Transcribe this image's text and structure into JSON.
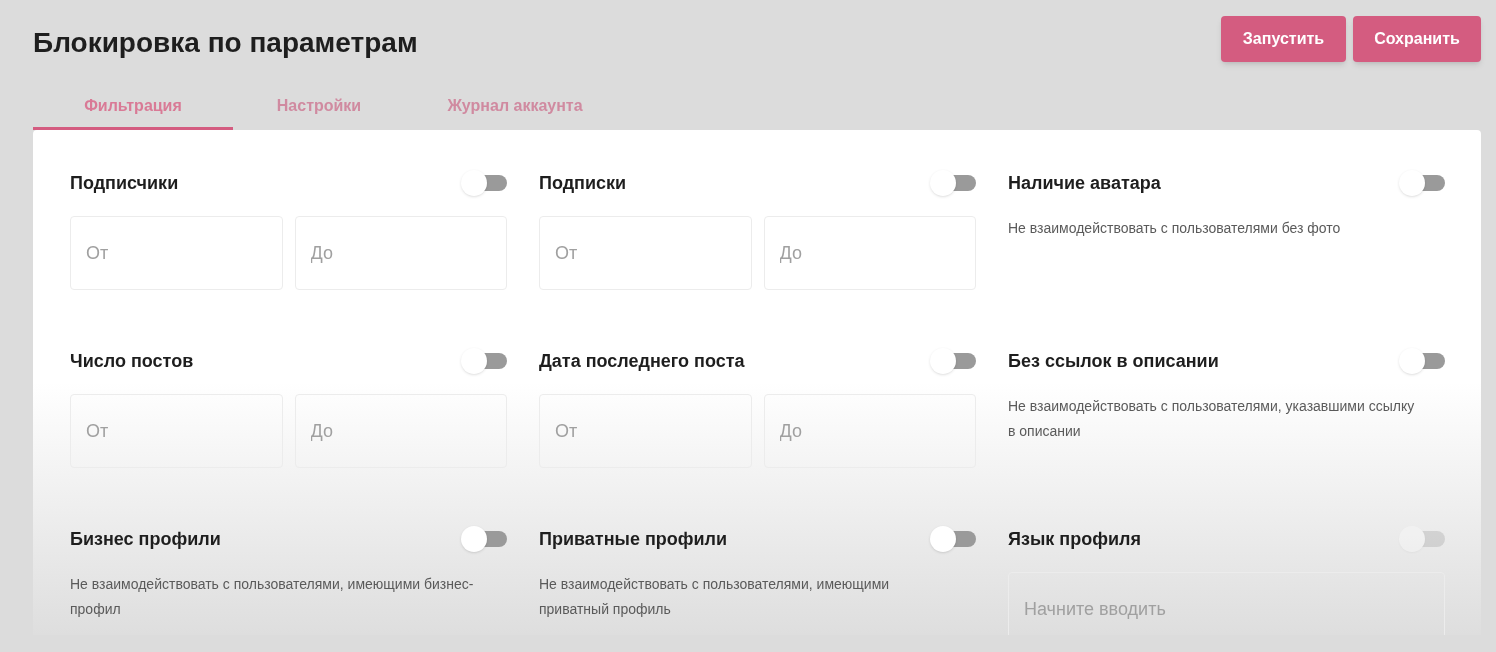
{
  "page_title": "Блокировка по параметрам",
  "buttons": [
    "Запустить",
    "Сохранить"
  ],
  "tabs": [
    {
      "label": "Фильтрация",
      "selected": true
    },
    {
      "label": "Настройки",
      "selected": false
    },
    {
      "label": "Журнал аккаунта",
      "selected": false
    }
  ],
  "filters": [
    {
      "kind": "range",
      "title": "Подписчики",
      "on": false,
      "disabled": false,
      "from_placeholder": "От",
      "to_placeholder": "До"
    },
    {
      "kind": "range",
      "title": "Подписки",
      "on": false,
      "disabled": false,
      "from_placeholder": "От",
      "to_placeholder": "До"
    },
    {
      "kind": "note",
      "title": "Наличие аватара",
      "on": false,
      "disabled": false,
      "description": "Не взаимодействовать с пользователями без фото"
    },
    {
      "kind": "range",
      "title": "Число постов",
      "on": false,
      "disabled": false,
      "from_placeholder": "От",
      "to_placeholder": "До"
    },
    {
      "kind": "range",
      "title": "Дата последнего поста",
      "on": false,
      "disabled": false,
      "from_placeholder": "От",
      "to_placeholder": "До"
    },
    {
      "kind": "note",
      "title": "Без ссылок в описании",
      "on": false,
      "disabled": false,
      "description": "Не взаимодействовать с пользователями, указавшими ссылку в описании"
    },
    {
      "kind": "note",
      "title": "Бизнес профили",
      "on": false,
      "disabled": false,
      "description": "Не взаимодействовать с пользователями, имеющими бизнес-профил"
    },
    {
      "kind": "note",
      "title": "Приватные профили",
      "on": false,
      "disabled": false,
      "description": "Не взаимодействовать с пользователями, имеющими приватный профиль"
    },
    {
      "kind": "search",
      "title": "Язык профиля",
      "on": false,
      "disabled": true,
      "placeholder": "Начните вводить"
    }
  ]
}
